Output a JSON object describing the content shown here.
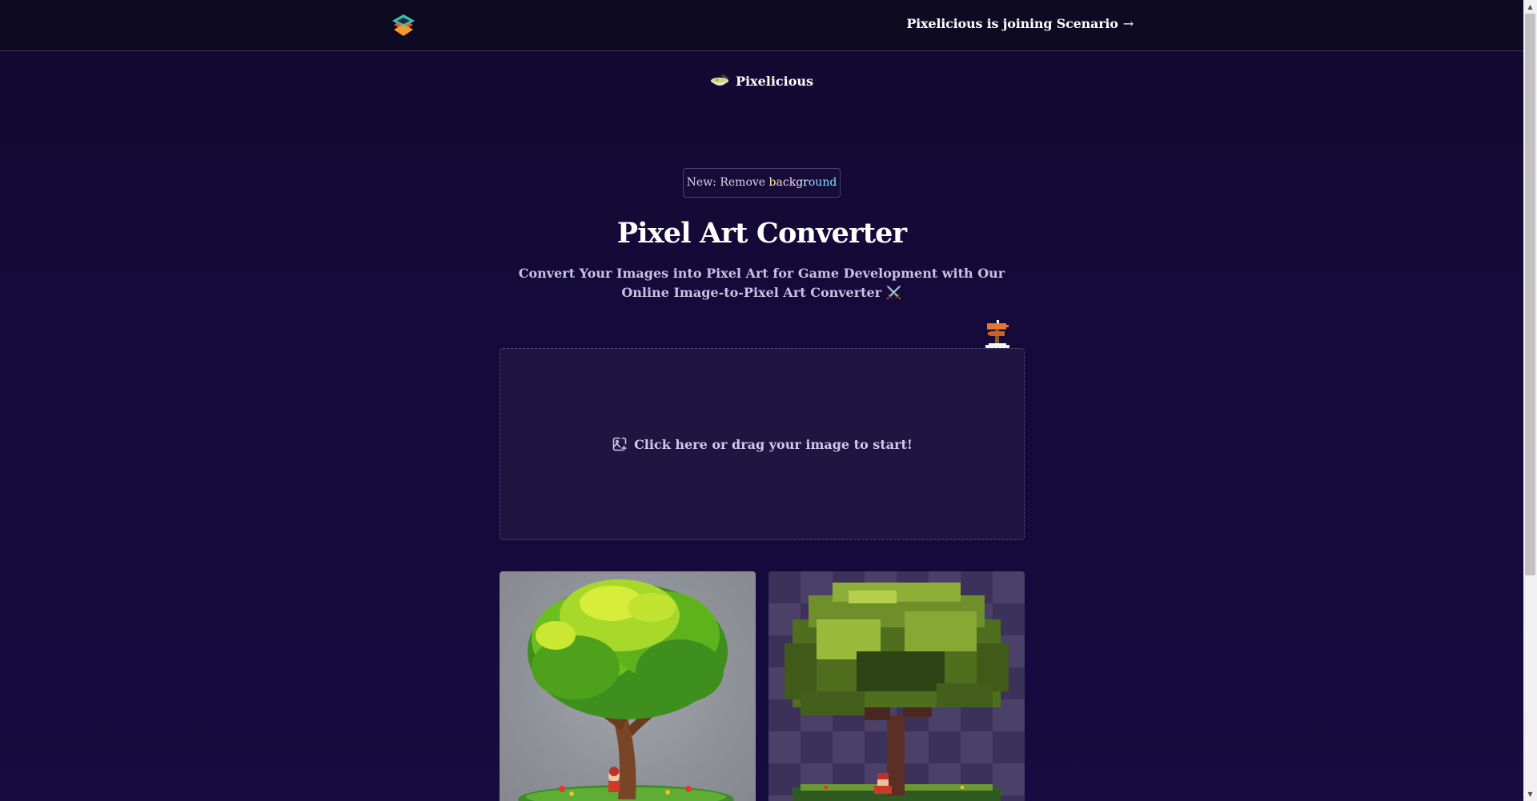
{
  "topbar": {
    "logo_name": "scenario-logo",
    "announcement": "Pixelicious is joining Scenario",
    "announcement_arrow": "→"
  },
  "brand": {
    "name": "Pixelicious",
    "icon": "noodle-bowl-icon"
  },
  "badge": {
    "prefix": "New: Remove ",
    "highlight_chars": [
      "b",
      "a",
      "c",
      "k",
      "g",
      "r",
      "o",
      "u",
      "n",
      "d"
    ]
  },
  "hero": {
    "title": "Pixel Art Converter",
    "subtitle": "Convert Your Images into Pixel Art for Game Development with Our Online Image-to-Pixel Art Converter ⚔️"
  },
  "dropzone": {
    "label": "Click here or drag your image to start!",
    "icon": "image-plus-icon"
  },
  "examples": {
    "original_alt": "Original tree image",
    "pixel_alt": "Pixel art tree image"
  },
  "colors": {
    "background": "#140a35",
    "topbar": "#0d0a22",
    "dropzone": "#1e1540",
    "accent_orange": "#e8772e",
    "tree_green": "#7fc21e"
  }
}
